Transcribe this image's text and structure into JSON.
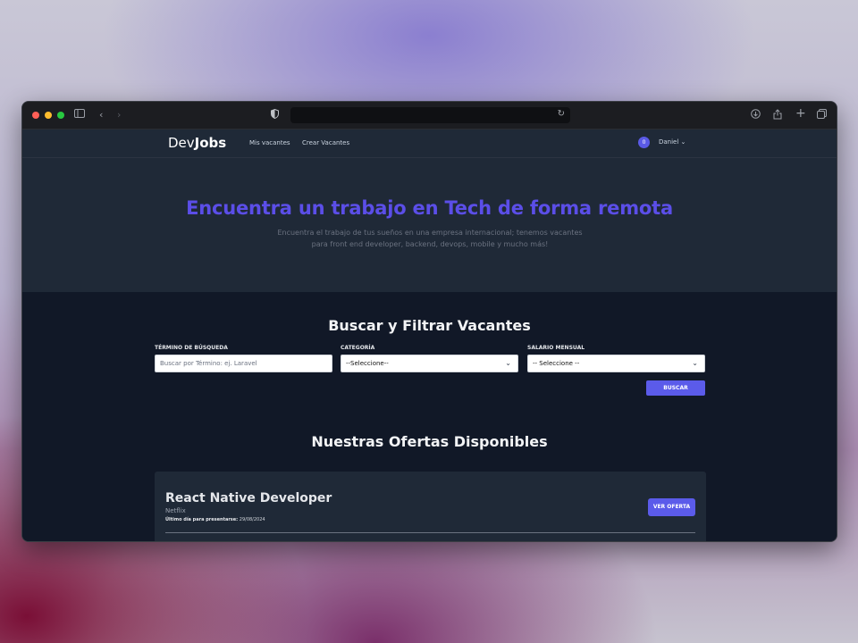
{
  "browser": {
    "shield_icon": "shield-icon",
    "reload_icon": "reload-icon"
  },
  "header": {
    "logo_prefix": "Dev",
    "logo_bold": "Jobs",
    "nav": [
      "Mis vacantes",
      "Crear Vacantes"
    ],
    "notification_count": "0",
    "user_name": "Daniel"
  },
  "hero": {
    "title": "Encuentra un trabajo en Tech de forma remota",
    "subtitle_line1": "Encuentra el trabajo de tus sueños en una empresa internacional; tenemos vacantes",
    "subtitle_line2": "para front end developer, backend, devops, mobile y mucho más!"
  },
  "search": {
    "title": "Buscar y Filtrar Vacantes",
    "term_label": "TÉRMINO DE BÚSQUEDA",
    "term_placeholder": "Buscar por Término: ej. Laravel",
    "category_label": "CATEGORÍA",
    "category_value": "--Seleccione--",
    "salary_label": "SALARIO MENSUAL",
    "salary_value": "-- Seleccione --",
    "button": "BUSCAR"
  },
  "offers": {
    "title": "Nuestras Ofertas Disponibles",
    "jobs": [
      {
        "title": "React Native Developer",
        "company": "Netflix",
        "deadline_label": "Último día para presentarse:",
        "deadline": "29/08/2024",
        "button": "VER OFERTA"
      }
    ]
  },
  "colors": {
    "accent": "#5b4ee8",
    "button": "#5b5bea",
    "header_bg": "#1f2937",
    "page_bg": "#111827"
  }
}
